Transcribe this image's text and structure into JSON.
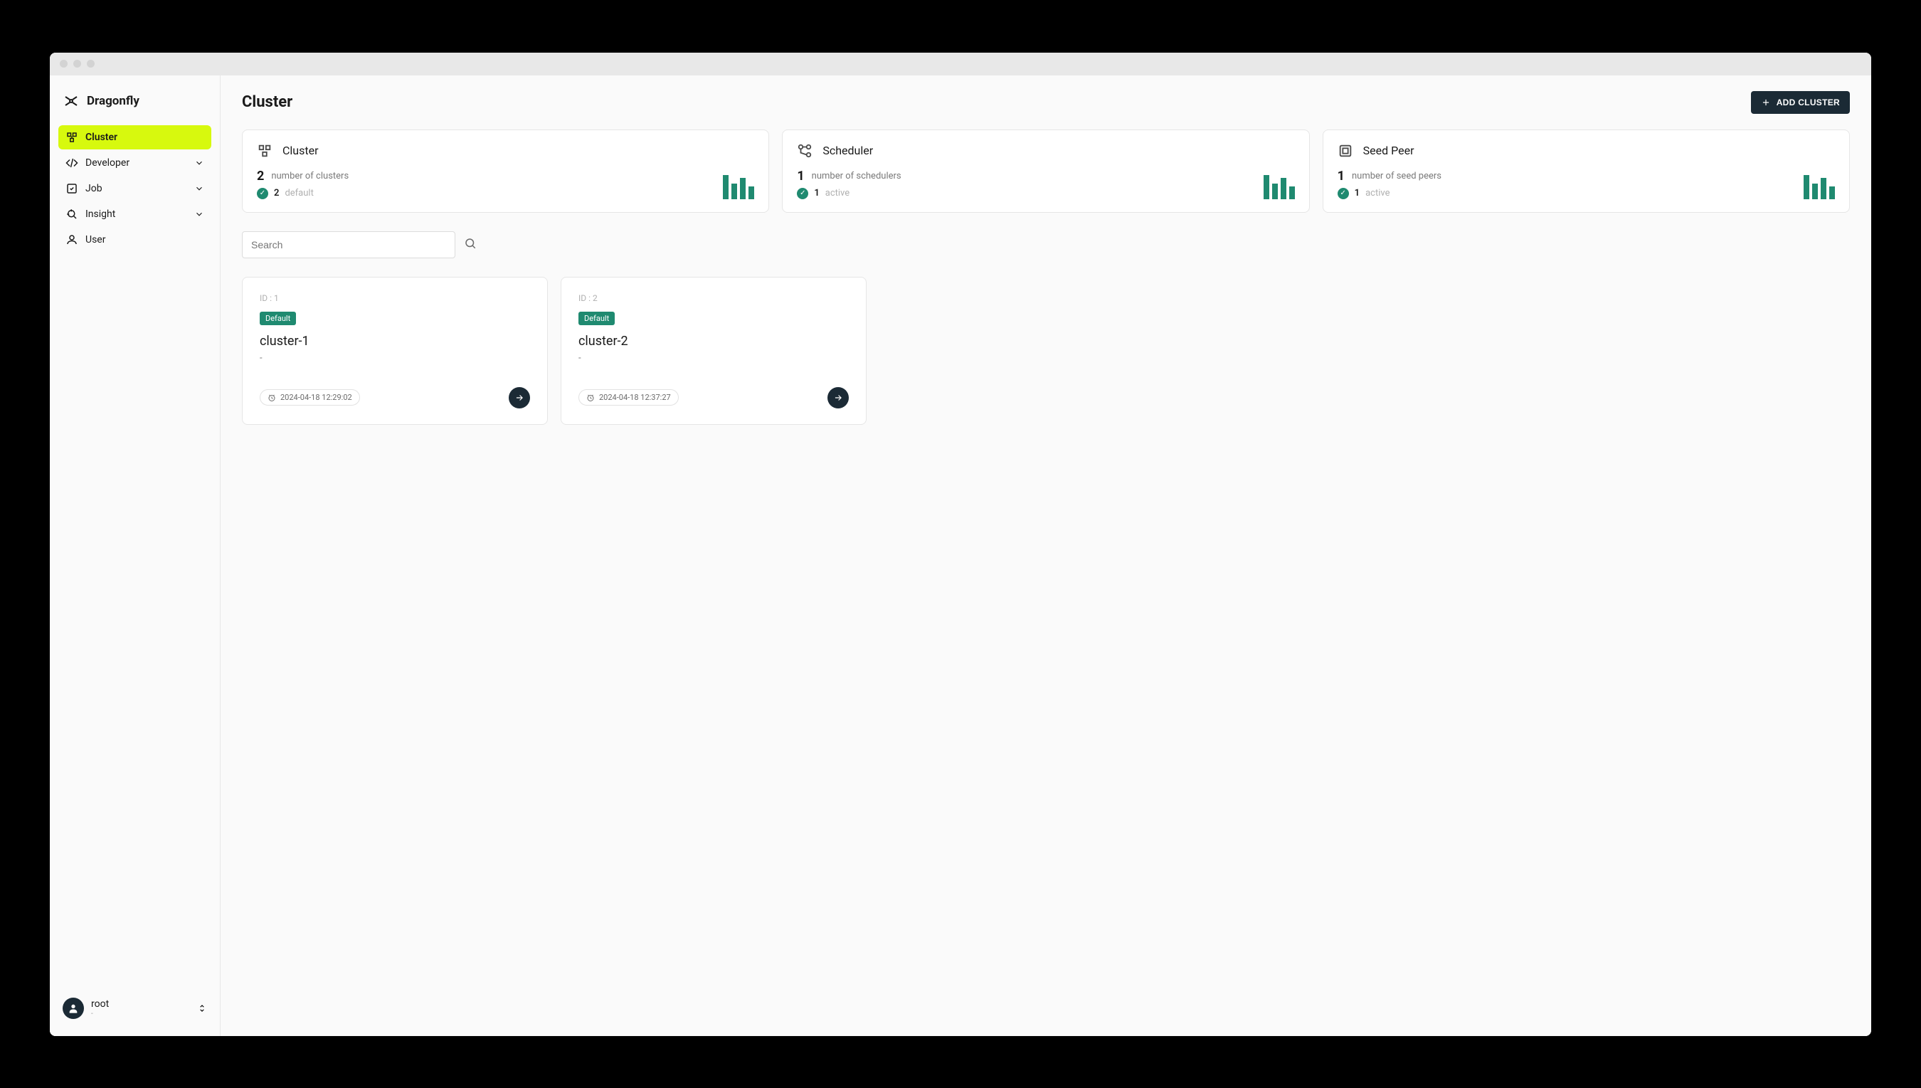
{
  "brand": {
    "name": "Dragonfly"
  },
  "nav": {
    "cluster": "Cluster",
    "developer": "Developer",
    "job": "Job",
    "insight": "Insight",
    "user": "User"
  },
  "sidebar_user": {
    "name": "root",
    "role": "-"
  },
  "page": {
    "title": "Cluster",
    "add_button": "ADD CLUSTER"
  },
  "stats": {
    "cluster": {
      "title": "Cluster",
      "count": "2",
      "count_label": "number of clusters",
      "sub_count": "2",
      "sub_label": "default"
    },
    "scheduler": {
      "title": "Scheduler",
      "count": "1",
      "count_label": "number of schedulers",
      "sub_count": "1",
      "sub_label": "active"
    },
    "seedpeer": {
      "title": "Seed Peer",
      "count": "1",
      "count_label": "number of seed peers",
      "sub_count": "1",
      "sub_label": "active"
    }
  },
  "search": {
    "placeholder": "Search"
  },
  "clusters": [
    {
      "id_label": "ID : 1",
      "badge": "Default",
      "name": "cluster-1",
      "desc": "-",
      "time": "2024-04-18 12:29:02"
    },
    {
      "id_label": "ID : 2",
      "badge": "Default",
      "name": "cluster-2",
      "desc": "-",
      "time": "2024-04-18 12:37:27"
    }
  ]
}
